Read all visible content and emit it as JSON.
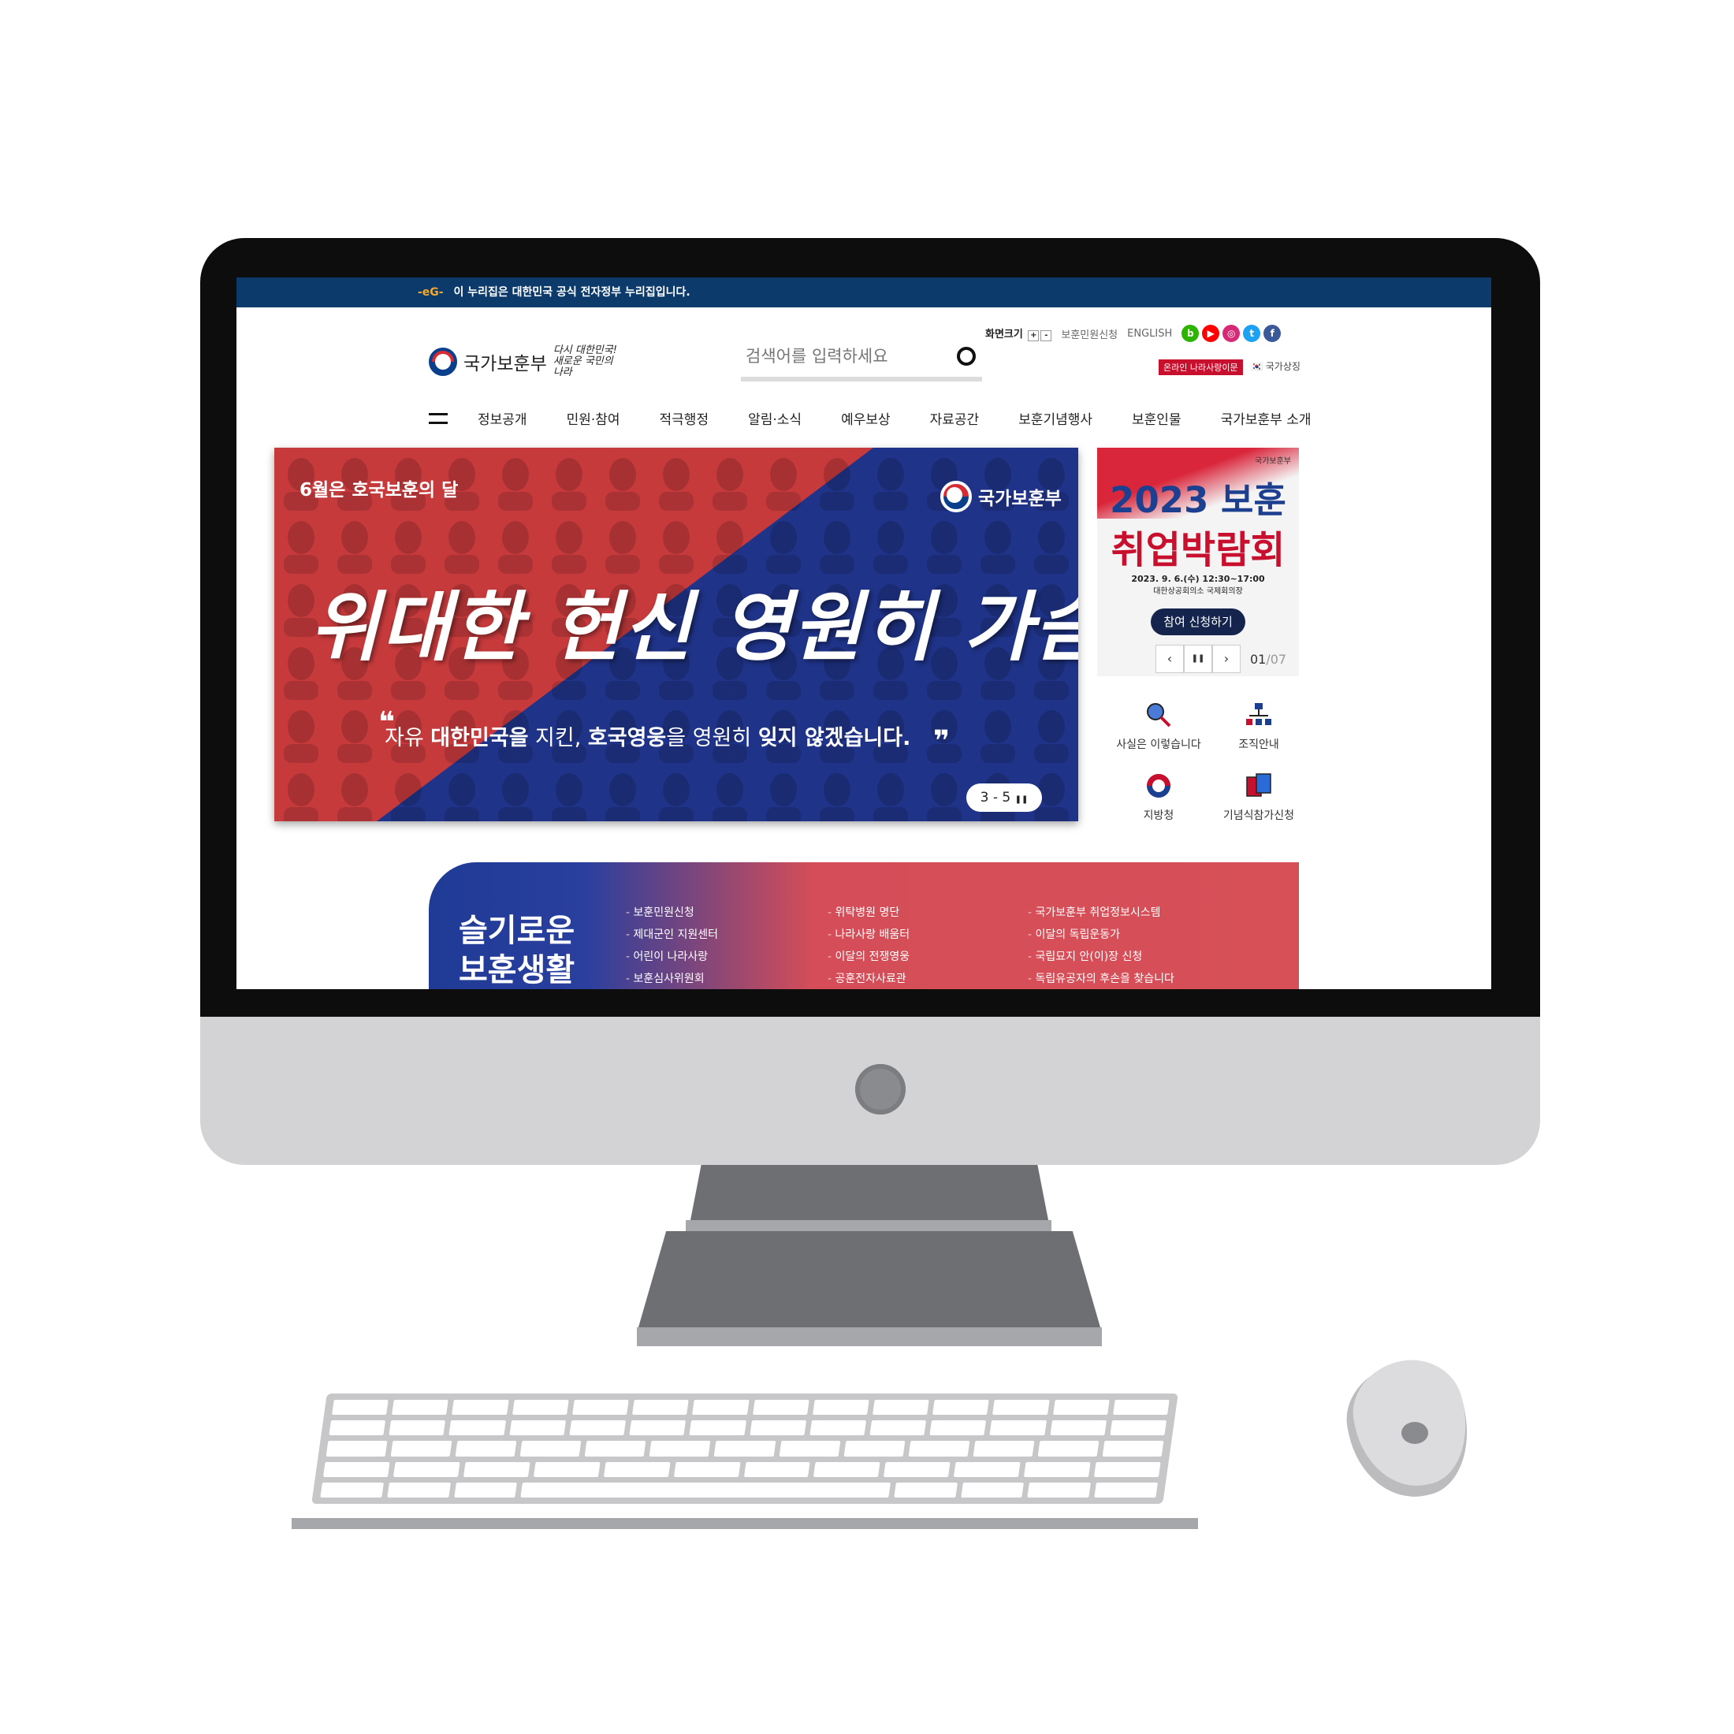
{
  "gov_bar": {
    "mark": "-eG-",
    "text": "이 누리집은 대한민국 공식 전자정부 누리집입니다."
  },
  "header": {
    "logo_text": "국가보훈부",
    "slogan": "다시 대한민국! 새로운 국민의 나라",
    "search_placeholder": "검색어를 입력하세요",
    "util": {
      "zoom_label": "화면크기",
      "zoom_in": "+",
      "zoom_out": "-",
      "civil": "보훈민원신청",
      "english": "ENGLISH",
      "online": "온라인 나라사랑이문",
      "symbol": "국가상징"
    },
    "sns": [
      {
        "name": "blog",
        "glyph": "b",
        "color": "#2db400"
      },
      {
        "name": "youtube",
        "glyph": "▶",
        "color": "#ff0000"
      },
      {
        "name": "instagram",
        "glyph": "◎",
        "color": "#d62976"
      },
      {
        "name": "twitter",
        "glyph": "t",
        "color": "#1da1f2"
      },
      {
        "name": "facebook",
        "glyph": "f",
        "color": "#3b5998"
      }
    ]
  },
  "gnb": [
    "정보공개",
    "민원·참여",
    "적극행정",
    "알림·소식",
    "예우보상",
    "자료공간",
    "보훈기념행사",
    "보훈인물",
    "국가보훈부 소개"
  ],
  "hero": {
    "kicker": "6월은 호국보훈의 달",
    "logo": "국가보훈부",
    "title": "위대한 헌신 영원히 가슴에",
    "sub_1": "자유 ",
    "sub_2": "대한민국을",
    "sub_3": " 지킨, ",
    "sub_4": "호국영웅",
    "sub_5": "을 영원히 ",
    "sub_6": "잊지 않겠습니다.",
    "quote_open": "❝",
    "quote_close": "❞",
    "pager": "3 - 5",
    "pause": "❚❚",
    "colors": {
      "red": "#c73a3c",
      "blue": "#1f3388"
    }
  },
  "promo": {
    "org": "국가보훈부",
    "title_1": "2023 보훈",
    "title_2": "취업박람회",
    "date": "2023. 9. 6.(수) 12:30~17:00",
    "place": "대한상공회의소 국제회의장",
    "button": "참여 신청하기",
    "prev": "‹",
    "pause": "❚❚",
    "next": "›",
    "current": "01",
    "total": "/07"
  },
  "quick_links": [
    {
      "label": "사실은 이렇습니다",
      "icon": "magnifier-icon"
    },
    {
      "label": "조직안내",
      "icon": "org-chart-icon"
    },
    {
      "label": "지방청",
      "icon": "taeguk-icon"
    },
    {
      "label": "기념식참가신청",
      "icon": "cards-icon"
    }
  ],
  "life": {
    "title_1": "슬기로운",
    "title_2": "보훈생활",
    "col_1": [
      "보훈민원신청",
      "제대군인 지원센터",
      "어린이 나라사랑",
      "보훈심사위원회"
    ],
    "col_2": [
      "위탁병원 명단",
      "나라사랑 배움터",
      "이달의 전쟁영웅",
      "공훈전자사료관"
    ],
    "col_3": [
      "국가보훈부 취업정보시스템",
      "이달의 독립운동가",
      "국립묘지 안(이)장 신청",
      "독립유공자의 후손을 찾습니다"
    ]
  }
}
